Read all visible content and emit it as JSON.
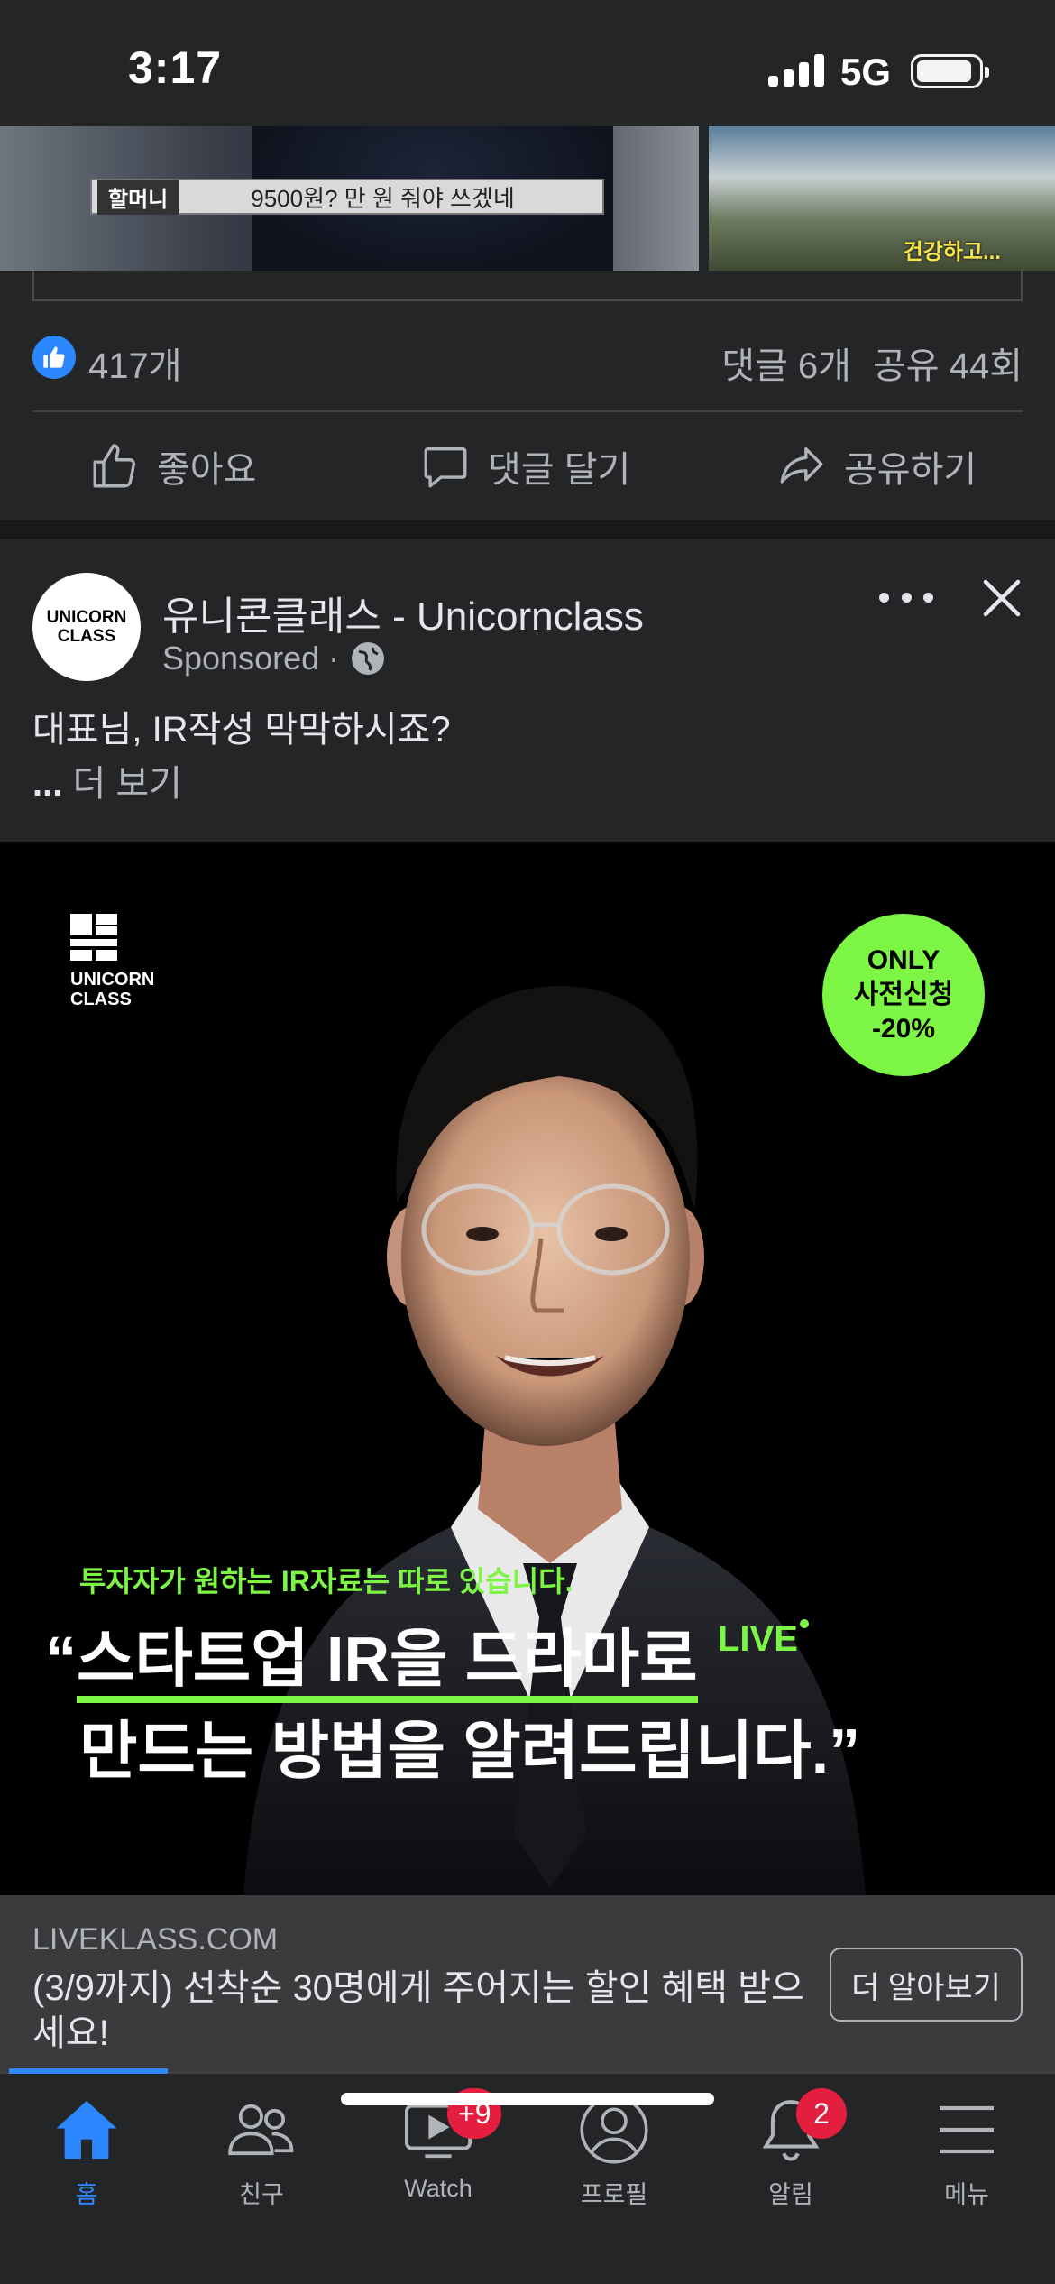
{
  "status_bar": {
    "time": "3:17",
    "network": "5G"
  },
  "previous_post": {
    "subtitle_speaker": "할머니",
    "subtitle_text": "9500원? 만 원 줘야 쓰겠네",
    "store_caption": "건강하고...",
    "like_count": "417개",
    "comments": "댓글 6개",
    "shares": "공유 44회",
    "actions": {
      "like": "좋아요",
      "comment": "댓글 달기",
      "share": "공유하기"
    }
  },
  "ad_post": {
    "page_name": "유니콘클래스 - Unicornclass",
    "avatar_line1": "UNICORN",
    "avatar_line2": "CLASS",
    "sponsored": "Sponsored ·",
    "text": "대표님, IR작성 막막하시죠?",
    "see_more_prefix": "...",
    "see_more": "더 보기",
    "creative": {
      "logo_line1": "UNICORN",
      "logo_line2": "CLASS",
      "badge_line1": "ONLY",
      "badge_line2": "사전신청",
      "badge_line3": "-20%",
      "tagline": "투자자가 원하는 IR자료는 따로 있습니다.",
      "quote_open": "“",
      "quote_line1": "스타트업 IR을 드라마로",
      "live_tag": "LIVE",
      "quote_line2": "만드는 방법을 알려드립니다.”"
    },
    "cta": {
      "domain": "LIVEKLASS.COM",
      "headline": "(3/9까지) 선착순 30명에게 주어지는 할인 혜택 받으세요!",
      "button": "더 알아보기"
    }
  },
  "bottom_nav": {
    "items": [
      {
        "label": "홈",
        "icon": "home-icon",
        "active": true
      },
      {
        "label": "친구",
        "icon": "friends-icon"
      },
      {
        "label": "Watch",
        "icon": "watch-icon",
        "badge": "+9"
      },
      {
        "label": "프로필",
        "icon": "profile-icon"
      },
      {
        "label": "알림",
        "icon": "bell-icon",
        "badge": "2"
      },
      {
        "label": "메뉴",
        "icon": "menu-icon"
      }
    ]
  },
  "colors": {
    "background": "#242526",
    "accent_blue": "#2d88ff",
    "creative_green": "#7cf544",
    "badge_red": "#e41e3f"
  }
}
